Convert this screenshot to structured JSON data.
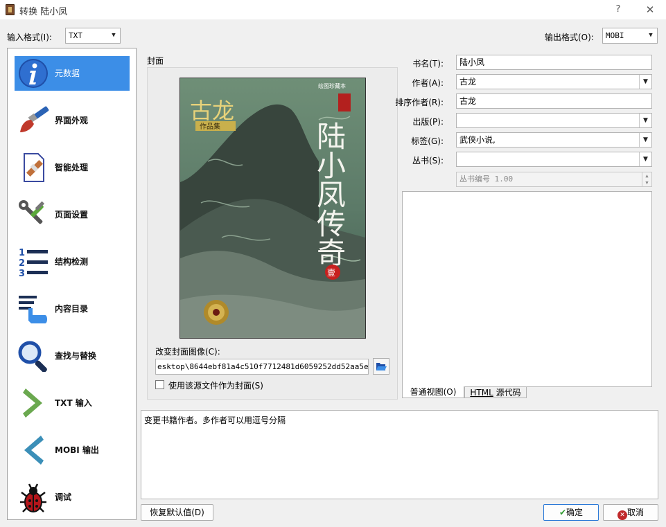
{
  "window": {
    "title": "转换 陆小凤",
    "help": "?",
    "close": "✕"
  },
  "top": {
    "input_label": "输入格式(I):",
    "input_value": "TXT",
    "output_label": "输出格式(O):",
    "output_value": "MOBI"
  },
  "sidebar": {
    "items": [
      {
        "label": "元数据",
        "icon": "info-icon"
      },
      {
        "label": "界面外观",
        "icon": "paintbrush-icon"
      },
      {
        "label": "智能处理",
        "icon": "document-wand-icon"
      },
      {
        "label": "页面设置",
        "icon": "wrench-screwdriver-icon"
      },
      {
        "label": "结构检测",
        "icon": "numbered-list-icon"
      },
      {
        "label": "内容目录",
        "icon": "toc-pointer-icon"
      },
      {
        "label": "查找与替换",
        "icon": "magnifier-icon"
      },
      {
        "label": "TXT 输入",
        "icon": "arrow-right-icon"
      },
      {
        "label": "MOBI 输出",
        "icon": "arrow-left-icon"
      },
      {
        "label": "调试",
        "icon": "bug-icon"
      }
    ]
  },
  "cover": {
    "group_title": "封面",
    "change_label": "改变封面图像(C):",
    "path": "esktop\\8644ebf81a4c510f7712481d6059252dd52aa5e7.jpg",
    "use_source_label": "使用该源文件作为封面(S)",
    "use_source_checked": false,
    "image": {
      "series": "古龙",
      "series_sub": "作品集",
      "title": "陆小凤传奇",
      "top_tag": "绘图珍藏本",
      "volume": "壹"
    }
  },
  "meta": {
    "title_label": "书名(T):",
    "title_value": "陆小凤",
    "author_label": "作者(A):",
    "author_value": "古龙",
    "sort_label": "排序作者(R):",
    "sort_value": "古龙",
    "publisher_label": "出版(P):",
    "publisher_value": "",
    "tags_label": "标签(G):",
    "tags_value": "武侠小说,",
    "series_label": "丛书(S):",
    "series_value": "",
    "series_index": "丛书编号 1.00"
  },
  "tabs": {
    "normal": "普通视图(O)",
    "html_prefix": "HTML",
    "html_suffix": " 源代码"
  },
  "help_text": "变更书籍作者。多作者可以用逗号分隔",
  "buttons": {
    "restore": "恢复默认值(D)",
    "ok": "确定",
    "cancel": "取消"
  }
}
